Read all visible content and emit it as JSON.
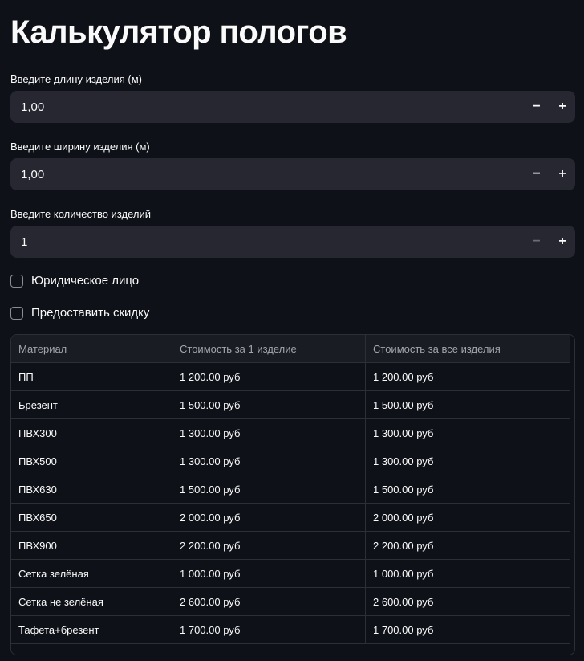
{
  "title": "Калькулятор пологов",
  "inputs": [
    {
      "label": "Введите длину изделия (м)",
      "value": "1,00",
      "minus": "−",
      "plus": "+"
    },
    {
      "label": "Введите ширину изделия (м)",
      "value": "1,00",
      "minus": "−",
      "plus": "+"
    },
    {
      "label": "Введите количество изделий",
      "value": "1",
      "minus": "−",
      "plus": "+"
    }
  ],
  "checkboxes": [
    {
      "label": "Юридическое лицо",
      "checked": false
    },
    {
      "label": "Предоставить скидку",
      "checked": false
    }
  ],
  "table": {
    "headers": [
      "Материал",
      "Стоимость за 1 изделие",
      "Стоимость за все изделия"
    ],
    "rows": [
      [
        "ПП",
        "1 200.00 руб",
        "1 200.00 руб"
      ],
      [
        "Брезент",
        "1 500.00 руб",
        "1 500.00 руб"
      ],
      [
        "ПВХ300",
        "1 300.00 руб",
        "1 300.00 руб"
      ],
      [
        "ПВХ500",
        "1 300.00 руб",
        "1 300.00 руб"
      ],
      [
        "ПВХ630",
        "1 500.00 руб",
        "1 500.00 руб"
      ],
      [
        "ПВХ650",
        "2 000.00 руб",
        "2 000.00 руб"
      ],
      [
        "ПВХ900",
        "2 200.00 руб",
        "2 200.00 руб"
      ],
      [
        "Сетка зелёная",
        "1 000.00 руб",
        "1 000.00 руб"
      ],
      [
        "Сетка не зелёная",
        "2 600.00 руб",
        "2 600.00 руб"
      ],
      [
        "Тафета+брезент",
        "1 700.00 руб",
        "1 700.00 руб"
      ]
    ]
  }
}
